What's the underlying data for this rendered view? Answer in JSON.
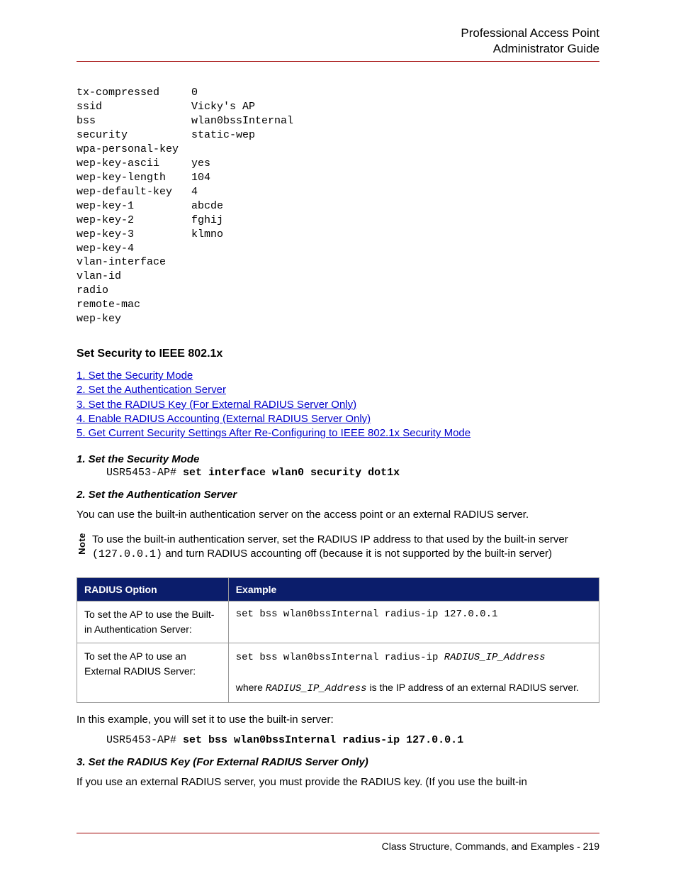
{
  "header": {
    "line1": "Professional Access Point",
    "line2": "Administrator Guide"
  },
  "config_rows": [
    [
      "tx-compressed",
      "0"
    ],
    [
      "ssid",
      "Vicky's AP"
    ],
    [
      "bss",
      "wlan0bssInternal"
    ],
    [
      "security",
      "static-wep"
    ],
    [
      "wpa-personal-key",
      ""
    ],
    [
      "wep-key-ascii",
      "yes"
    ],
    [
      "wep-key-length",
      "104"
    ],
    [
      "wep-default-key",
      "4"
    ],
    [
      "wep-key-1",
      "abcde"
    ],
    [
      "wep-key-2",
      "fghij"
    ],
    [
      "wep-key-3",
      "klmno"
    ],
    [
      "wep-key-4",
      ""
    ],
    [
      "vlan-interface",
      ""
    ],
    [
      "vlan-id",
      ""
    ],
    [
      "radio",
      ""
    ],
    [
      "remote-mac",
      ""
    ],
    [
      "wep-key",
      ""
    ]
  ],
  "section_title": "Set Security to IEEE 802.1x",
  "toc": [
    "1. Set the Security Mode",
    "2. Set the Authentication Server",
    "3. Set the RADIUS Key (For External RADIUS Server Only)",
    "4. Enable RADIUS Accounting (External RADIUS Server Only)",
    "5. Get Current Security Settings After Re-Configuring to IEEE 802.1x Security Mode"
  ],
  "sec1": {
    "heading": "1. Set the Security Mode",
    "prompt": "USR5453-AP# ",
    "cmd": "set interface wlan0 security dot1x"
  },
  "sec2": {
    "heading": "2. Set the Authentication Server",
    "intro": "You can use the built-in authentication server on the access point or an external RADIUS server."
  },
  "note": {
    "label": "Note",
    "line1_pre": "To use the built-in authentication server, set the RADIUS IP address to that used by the built-in server",
    "line2_ip": "(127.0.0.1)",
    "line2_post": " and turn RADIUS accounting off (because it is not supported by the built-in server)"
  },
  "table": {
    "head_col1": "RADIUS Option",
    "head_col2": "Example",
    "row1_opt": "To set the AP to use the Built-in Authentication Server:",
    "row1_ex": "set bss wlan0bssInternal radius-ip 127.0.0.1",
    "row2_opt": "To set the AP to use an External RADIUS Server:",
    "row2_ex_cmd": "set bss wlan0bssInternal radius-ip ",
    "row2_ex_arg": "RADIUS_IP_Address",
    "row2_note_pre": "where ",
    "row2_note_mono": "RADIUS_IP_Address",
    "row2_note_post": " is the IP address of an external RADIUS server."
  },
  "example_intro": "In this example, you will set it to use the built-in server:",
  "example_prompt": "USR5453-AP# ",
  "example_cmd": "set bss wlan0bssInternal radius-ip 127.0.0.1",
  "sec3": {
    "heading": "3. Set the RADIUS Key (For External RADIUS Server Only)",
    "text": "If you use an external RADIUS server, you must provide the RADIUS key. (If you use the built-in"
  },
  "footer": {
    "text": "Class Structure, Commands, and Examples - 219"
  }
}
